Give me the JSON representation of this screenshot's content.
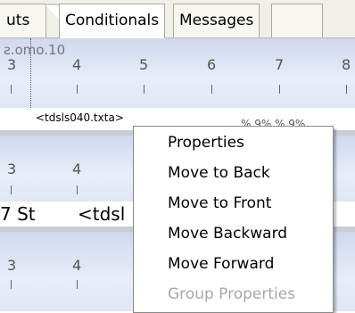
{
  "tabs": [
    {
      "label": "uts"
    },
    {
      "label": "Conditionals"
    },
    {
      "label": "Messages"
    }
  ],
  "ruler_top": {
    "label": "ƨ.omo.10",
    "numbers": [
      "3",
      "4",
      "5",
      "6",
      "7",
      "8"
    ]
  },
  "field_row": {
    "field_text": "<tdsls040.txta>",
    "trail_text": "% 9%     % 9%"
  },
  "ruler_mid": {
    "numbers": [
      "3",
      "4"
    ]
  },
  "data_row": {
    "left_text": "7 St",
    "field_text": "<tdsl"
  },
  "ruler_bottom": {
    "numbers": [
      "3",
      "4"
    ]
  },
  "context_menu": {
    "items": [
      {
        "label": "Properties",
        "enabled": true
      },
      {
        "label": "Move to Back",
        "enabled": true
      },
      {
        "label": "Move to Front",
        "enabled": true
      },
      {
        "label": "Move Backward",
        "enabled": true
      },
      {
        "label": "Move Forward",
        "enabled": true
      },
      {
        "label": "Group Properties",
        "enabled": false
      }
    ]
  },
  "colors": {
    "ruler": "#dfe6f5",
    "menu_disabled": "#a8a8a8"
  }
}
